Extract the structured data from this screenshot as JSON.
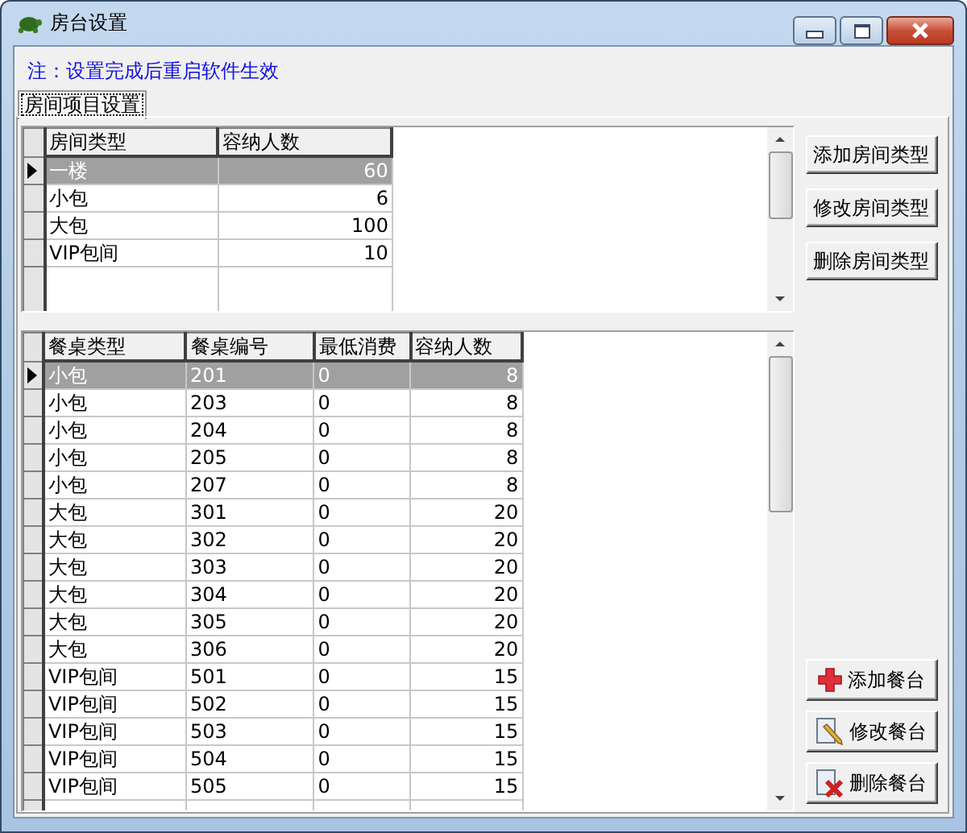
{
  "window": {
    "title": "房台设置"
  },
  "notice": "注：设置完成后重启软件生效",
  "tabs": [
    {
      "label": "房间项目设置",
      "selected": true
    }
  ],
  "room_table": {
    "columns": [
      "房间类型",
      "容纳人数"
    ],
    "rows": [
      {
        "cells": [
          "一楼",
          "60"
        ],
        "selected": true
      },
      {
        "cells": [
          "小包",
          "6"
        ],
        "selected": false
      },
      {
        "cells": [
          "大包",
          "100"
        ],
        "selected": false
      },
      {
        "cells": [
          "VIP包间",
          "10"
        ],
        "selected": false
      }
    ]
  },
  "room_buttons": [
    {
      "label": "添加房间类型"
    },
    {
      "label": "修改房间类型"
    },
    {
      "label": "删除房间类型"
    }
  ],
  "table_grid": {
    "columns": [
      "餐桌类型",
      "餐桌编号",
      "最低消费",
      "容纳人数"
    ],
    "rows": [
      {
        "cells": [
          "小包",
          "201",
          "0",
          "8"
        ],
        "selected": true
      },
      {
        "cells": [
          "小包",
          "203",
          "0",
          "8"
        ],
        "selected": false
      },
      {
        "cells": [
          "小包",
          "204",
          "0",
          "8"
        ],
        "selected": false
      },
      {
        "cells": [
          "小包",
          "205",
          "0",
          "8"
        ],
        "selected": false
      },
      {
        "cells": [
          "小包",
          "207",
          "0",
          "8"
        ],
        "selected": false
      },
      {
        "cells": [
          "大包",
          "301",
          "0",
          "20"
        ],
        "selected": false
      },
      {
        "cells": [
          "大包",
          "302",
          "0",
          "20"
        ],
        "selected": false
      },
      {
        "cells": [
          "大包",
          "303",
          "0",
          "20"
        ],
        "selected": false
      },
      {
        "cells": [
          "大包",
          "304",
          "0",
          "20"
        ],
        "selected": false
      },
      {
        "cells": [
          "大包",
          "305",
          "0",
          "20"
        ],
        "selected": false
      },
      {
        "cells": [
          "大包",
          "306",
          "0",
          "20"
        ],
        "selected": false
      },
      {
        "cells": [
          "VIP包间",
          "501",
          "0",
          "15"
        ],
        "selected": false
      },
      {
        "cells": [
          "VIP包间",
          "502",
          "0",
          "15"
        ],
        "selected": false
      },
      {
        "cells": [
          "VIP包间",
          "503",
          "0",
          "15"
        ],
        "selected": false
      },
      {
        "cells": [
          "VIP包间",
          "504",
          "0",
          "15"
        ],
        "selected": false
      },
      {
        "cells": [
          "VIP包间",
          "505",
          "0",
          "15"
        ],
        "selected": false
      }
    ]
  },
  "table_buttons": [
    {
      "label": "添加餐台",
      "kind": "add"
    },
    {
      "label": "修改餐台",
      "kind": "edit"
    },
    {
      "label": "删除餐台",
      "kind": "delete"
    }
  ]
}
